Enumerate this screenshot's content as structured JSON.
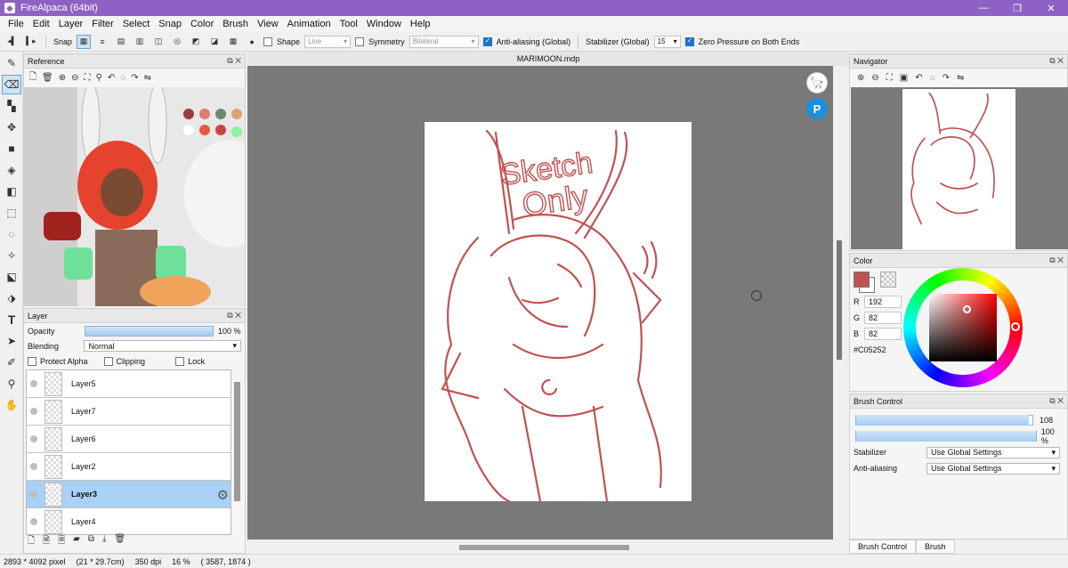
{
  "window": {
    "title": "FireAlpaca (64bit)",
    "minimize": "—",
    "maximize": "❐",
    "close": "✕"
  },
  "menu": [
    "File",
    "Edit",
    "Layer",
    "Filter",
    "Select",
    "Snap",
    "Color",
    "Brush",
    "View",
    "Animation",
    "Tool",
    "Window",
    "Help"
  ],
  "toolbar": {
    "snap_label": "Snap",
    "shape_label": "Shape",
    "shape_value": "Line",
    "symmetry_label": "Symmetry",
    "symmetry_value": "Bilateral",
    "antialias_label": "Anti-aliasing (Global)",
    "stabilizer_label": "Stabilizer (Global)",
    "stabilizer_value": "15",
    "zero_pressure_label": "Zero Pressure on Both Ends"
  },
  "reference": {
    "title": "Reference"
  },
  "layer_panel": {
    "title": "Layer",
    "opacity_label": "Opacity",
    "opacity_value": "100 %",
    "opacity_fraction": 1.0,
    "blending_label": "Blending",
    "blending_value": "Normal",
    "protect_alpha": "Protect Alpha",
    "clipping": "Clipping",
    "lock": "Lock",
    "layers": [
      {
        "name": "Layer5",
        "selected": false
      },
      {
        "name": "Layer7",
        "selected": false
      },
      {
        "name": "Layer6",
        "selected": false
      },
      {
        "name": "Layer2",
        "selected": false
      },
      {
        "name": "Layer3",
        "selected": true
      },
      {
        "name": "Layer4",
        "selected": false
      }
    ]
  },
  "canvas": {
    "tab_title": "MARIMOON.mdp",
    "sketch_text_1": "Sketch",
    "sketch_text_2": "Only"
  },
  "navigator": {
    "title": "Navigator"
  },
  "color": {
    "title": "Color",
    "r_label": "R",
    "r": "192",
    "g_label": "G",
    "g": "82",
    "b_label": "B",
    "b": "82",
    "hex": "#C05252",
    "primary": "#C05252"
  },
  "brush_control": {
    "title": "Brush Control",
    "size_value": "108",
    "size_fraction": 0.98,
    "opacity_value": "100 %",
    "opacity_fraction": 1.0,
    "stabilizer_label": "Stabilizer",
    "stabilizer_value": "Use Global Settings",
    "antialias_label": "Anti-aliasing",
    "antialias_value": "Use Global Settings"
  },
  "bottom_tabs": [
    "Brush Control",
    "Brush"
  ],
  "status": {
    "size": "2893 * 4092 pixel",
    "physical": "(21 * 29.7cm)",
    "dpi": "350 dpi",
    "zoom": "16 %",
    "coords": "( 3587, 1874 )"
  }
}
